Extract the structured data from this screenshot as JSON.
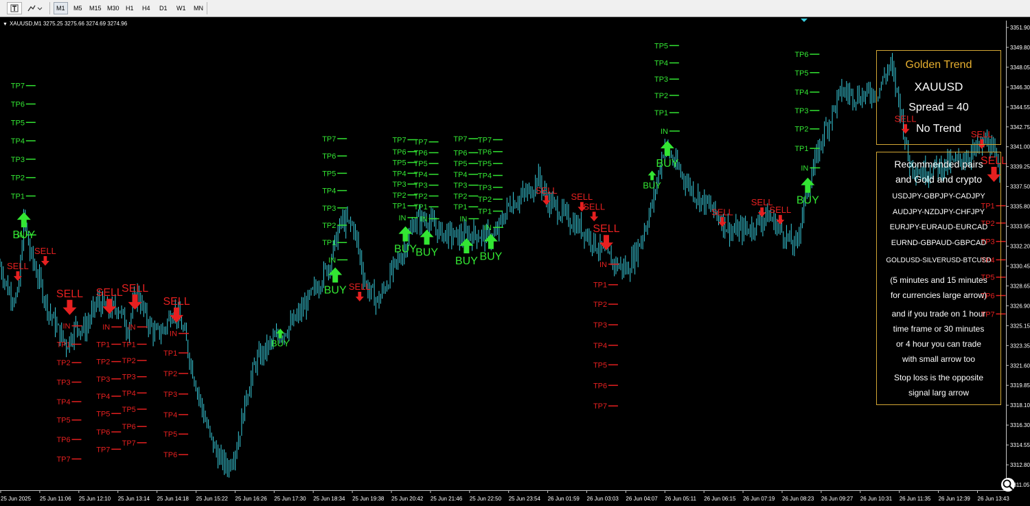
{
  "toolbar": {
    "icons": [
      "text-tool-icon",
      "shapes-tool-icon"
    ],
    "timeframes": [
      "M1",
      "M5",
      "M15",
      "M30",
      "H1",
      "H4",
      "D1",
      "W1",
      "MN"
    ],
    "active_timeframe": "M1"
  },
  "symbol_info": "XAUUSD,M1  3275.25 3275.66 3274.69 3274.96",
  "colors": {
    "background": "#000000",
    "candle": "#3ad0e0",
    "buy": "#33e633",
    "sell": "#e62020",
    "box_border": "#d4a835",
    "box_title": "#e8b030"
  },
  "info_box": {
    "title": "Golden Trend",
    "symbol": "XAUUSD",
    "spread": "Spread = 40",
    "trend": "No Trend"
  },
  "recommend_box": {
    "heading_line1": "Recommended pairs",
    "heading_line2": "and Gold and crypto",
    "pairs": [
      "USDJPY-GBPJPY-CADJPY",
      "AUDJPY-NZDJPY-CHFJPY",
      "EURJPY-EURAUD-EURCAD",
      "EURND-GBPAUD-GBPCAD",
      "GOLDUSD-SILVERUSD-BTCUSD"
    ],
    "note_lines": [
      "(5 minutes and 15 minutes",
      "for currencies large arrow)",
      "and if you trade on 1 hour",
      "time frame or 30 minutes",
      "or 4 hour you can trade",
      "with small arrow too",
      "Stop loss is the opposite",
      "signal larg arrow"
    ]
  },
  "price_axis": [
    "3351.90",
    "3349.80",
    "3348.05",
    "3346.30",
    "3344.55",
    "3342.75",
    "3341.00",
    "3339.25",
    "3337.50",
    "3335.80",
    "3333.95",
    "3332.20",
    "3330.45",
    "3328.65",
    "3326.90",
    "3325.15",
    "3323.35",
    "3321.60",
    "3319.85",
    "3318.10",
    "3316.30",
    "3314.55",
    "3312.80",
    "3311.05"
  ],
  "time_axis": [
    "25 Jun 2025",
    "25 Jun 11:06",
    "25 Jun 12:10",
    "25 Jun 13:14",
    "25 Jun 14:18",
    "25 Jun 15:22",
    "25 Jun 16:26",
    "25 Jun 17:30",
    "25 Jun 18:34",
    "25 Jun 19:38",
    "25 Jun 20:42",
    "25 Jun 21:46",
    "25 Jun 22:50",
    "25 Jun 23:54",
    "26 Jun 01:59",
    "26 Jun 03:03",
    "26 Jun 04:07",
    "26 Jun 05:11",
    "26 Jun 06:15",
    "26 Jun 07:19",
    "26 Jun 08:23",
    "26 Jun 09:27",
    "26 Jun 10:31",
    "26 Jun 11:35",
    "26 Jun 12:39",
    "26 Jun 13:43"
  ],
  "signals": [
    {
      "type": "buy",
      "size": "large",
      "x_time": "25 Jun 10:40",
      "entry": 3333.2,
      "arrow": 3334.6,
      "tp": [
        3336.8,
        3338.5,
        3340.2,
        3341.9,
        3343.6,
        3345.3,
        3347.0
      ]
    },
    {
      "type": "sell",
      "size": "small",
      "x_time": "25 Jun 10:30",
      "arrow": 3329.4
    },
    {
      "type": "sell",
      "size": "small",
      "x_time": "25 Jun 11:15",
      "arrow": 3330.8
    },
    {
      "type": "sell",
      "size": "large",
      "x_time": "25 Jun 11:55",
      "entry": 3324.8,
      "arrow": 3326.5,
      "tp": [
        3323.1,
        3321.4,
        3319.6,
        3317.8,
        3316.1,
        3314.3,
        3312.5
      ]
    },
    {
      "type": "sell",
      "size": "large",
      "x_time": "25 Jun 13:00",
      "entry": 3324.7,
      "arrow": 3326.6,
      "tp": [
        3323.1,
        3321.5,
        3319.9,
        3318.3,
        3316.7,
        3315.0,
        3313.4
      ]
    },
    {
      "type": "sell",
      "size": "large",
      "x_time": "25 Jun 13:42",
      "entry": 3324.7,
      "arrow": 3327.0,
      "tp": [
        3323.1,
        3321.6,
        3320.1,
        3318.6,
        3317.1,
        3315.5,
        3314.0
      ]
    },
    {
      "type": "sell",
      "size": "large",
      "x_time": "25 Jun 14:50",
      "entry": 3324.1,
      "arrow": 3325.8,
      "tp": [
        3322.3,
        3320.4,
        3318.5,
        3316.6,
        3314.8,
        3312.9
      ]
    },
    {
      "type": "buy",
      "size": "small",
      "x_time": "25 Jun 17:40",
      "arrow": 3324.1
    },
    {
      "type": "buy",
      "size": "large",
      "x_time": "25 Jun 19:10",
      "entry": 3330.9,
      "arrow": 3329.5,
      "tp": [
        3332.5,
        3334.1,
        3335.7,
        3337.3,
        3338.9,
        3340.5,
        3342.1
      ]
    },
    {
      "type": "sell",
      "size": "small",
      "x_time": "25 Jun 19:50",
      "arrow": 3327.5
    },
    {
      "type": "buy",
      "size": "large",
      "x_time": "25 Jun 21:05",
      "entry": 3334.8,
      "arrow": 3333.3,
      "tp": [
        3335.9,
        3336.9,
        3337.9,
        3338.9,
        3339.9,
        3340.9,
        3342.0
      ]
    },
    {
      "type": "buy",
      "size": "large",
      "x_time": "25 Jun 21:40",
      "entry": 3334.7,
      "arrow": 3333.0,
      "tp": [
        3335.8,
        3336.8,
        3337.8,
        3338.8,
        3339.8,
        3340.8,
        3341.8
      ]
    },
    {
      "type": "buy",
      "size": "large",
      "x_time": "25 Jun 22:45",
      "entry": 3334.7,
      "arrow": 3332.2,
      "tp": [
        3335.8,
        3336.8,
        3337.8,
        3338.8,
        3339.8,
        3340.8,
        3342.1
      ]
    },
    {
      "type": "buy",
      "size": "large",
      "x_time": "25 Jun 23:25",
      "entry": 3333.9,
      "arrow": 3332.6,
      "tp": [
        3335.4,
        3336.5,
        3337.6,
        3338.7,
        3339.8,
        3340.9,
        3342.0
      ]
    },
    {
      "type": "sell",
      "size": "small",
      "x_time": "26 Jun 01:55",
      "arrow": 3336.4
    },
    {
      "type": "sell",
      "size": "small",
      "x_time": "26 Jun 02:55",
      "arrow": 3335.8
    },
    {
      "type": "sell",
      "size": "small",
      "x_time": "26 Jun 03:15",
      "arrow": 3334.9
    },
    {
      "type": "sell",
      "size": "large",
      "x_time": "26 Jun 03:35",
      "entry": 3330.5,
      "arrow": 3332.5,
      "tp": [
        3328.6,
        3326.8,
        3324.9,
        3323.0,
        3321.2,
        3319.3,
        3317.4
      ]
    },
    {
      "type": "buy",
      "size": "small",
      "x_time": "26 Jun 04:50",
      "arrow": 3338.7
    },
    {
      "type": "buy",
      "size": "large",
      "x_time": "26 Jun 05:15",
      "entry": 3342.8,
      "arrow": 3341.2,
      "tp": [
        3344.5,
        3346.1,
        3347.6,
        3349.1,
        3350.7
      ]
    },
    {
      "type": "sell",
      "size": "small",
      "x_time": "26 Jun 06:45",
      "arrow": 3334.4
    },
    {
      "type": "sell",
      "size": "small",
      "x_time": "26 Jun 07:50",
      "arrow": 3335.3
    },
    {
      "type": "sell",
      "size": "small",
      "x_time": "26 Jun 08:20",
      "arrow": 3334.6
    },
    {
      "type": "buy",
      "size": "large",
      "x_time": "26 Jun 09:05",
      "entry": 3339.4,
      "arrow": 3337.8,
      "tp": [
        3341.2,
        3343.0,
        3344.7,
        3346.4,
        3348.2,
        3349.9
      ]
    },
    {
      "type": "sell",
      "size": "small",
      "x_time": "26 Jun 11:45",
      "arrow": 3343.0
    },
    {
      "type": "sell",
      "size": "small",
      "x_time": "26 Jun 13:50",
      "arrow": 3341.6
    },
    {
      "type": "sell",
      "size": "large",
      "x_time": "26 Jun 14:10",
      "arrow": 3338.8,
      "tp": [
        3335.9,
        3334.3,
        3332.6,
        3330.9,
        3329.3,
        3327.6,
        3325.9
      ]
    }
  ],
  "chart_data": {
    "type": "line",
    "series": [
      {
        "x": [
          "25 Jun 10:00",
          "25 Jun 10:15",
          "25 Jun 10:30",
          "25 Jun 10:40",
          "25 Jun 10:50",
          "25 Jun 11:05",
          "25 Jun 11:20",
          "25 Jun 11:35",
          "25 Jun 11:50",
          "25 Jun 12:05",
          "25 Jun 12:20",
          "25 Jun 12:40",
          "25 Jun 13:00",
          "25 Jun 13:15",
          "25 Jun 13:30",
          "25 Jun 13:45",
          "25 Jun 14:00",
          "25 Jun 14:15",
          "25 Jun 14:30",
          "25 Jun 14:45",
          "25 Jun 15:00",
          "25 Jun 15:15",
          "25 Jun 15:30",
          "25 Jun 15:45",
          "25 Jun 16:00",
          "25 Jun 16:15",
          "25 Jun 16:30",
          "25 Jun 16:45",
          "25 Jun 17:00",
          "25 Jun 17:30",
          "25 Jun 18:00",
          "25 Jun 18:30",
          "25 Jun 19:00",
          "25 Jun 19:20",
          "25 Jun 19:40",
          "25 Jun 20:00",
          "25 Jun 20:20",
          "25 Jun 20:40",
          "25 Jun 21:00",
          "25 Jun 21:20",
          "25 Jun 21:40",
          "25 Jun 22:00",
          "25 Jun 22:30",
          "25 Jun 23:00",
          "25 Jun 23:30",
          "25 Jun 23:55",
          "26 Jun 01:00",
          "26 Jun 01:30",
          "26 Jun 01:55",
          "26 Jun 02:30",
          "26 Jun 03:00",
          "26 Jun 03:30",
          "26 Jun 03:50",
          "26 Jun 04:10",
          "26 Jun 04:30",
          "26 Jun 04:50",
          "26 Jun 05:10",
          "26 Jun 05:30",
          "26 Jun 06:00",
          "26 Jun 06:30",
          "26 Jun 07:00",
          "26 Jun 07:30",
          "26 Jun 08:00",
          "26 Jun 08:30",
          "26 Jun 08:45",
          "26 Jun 09:00",
          "26 Jun 09:30",
          "26 Jun 10:00",
          "26 Jun 10:30",
          "26 Jun 11:00",
          "26 Jun 11:20",
          "26 Jun 11:35",
          "26 Jun 11:50",
          "26 Jun 12:10",
          "26 Jun 12:40",
          "26 Jun 13:10",
          "26 Jun 13:40",
          "26 Jun 14:00",
          "26 Jun 14:20"
        ],
        "y": [
          3330.5,
          3328.0,
          3327.2,
          3334.8,
          3331.5,
          3329.0,
          3326.3,
          3324.5,
          3323.0,
          3324.8,
          3324.5,
          3327.0,
          3326.2,
          3326.6,
          3324.5,
          3328.0,
          3325.5,
          3324.0,
          3324.5,
          3326.5,
          3324.6,
          3321.0,
          3317.5,
          3314.5,
          3312.5,
          3311.8,
          3314.0,
          3318.5,
          3321.5,
          3323.5,
          3325.0,
          3327.5,
          3330.5,
          3334.5,
          3334.0,
          3328.5,
          3327.0,
          3329.5,
          3331.5,
          3334.5,
          3334.7,
          3333.5,
          3333.0,
          3333.3,
          3332.9,
          3336.0,
          3337.2,
          3338.5,
          3336.5,
          3334.8,
          3333.5,
          3331.5,
          3330.5,
          3330.0,
          3332.5,
          3336.0,
          3341.5,
          3339.5,
          3337.0,
          3335.5,
          3333.5,
          3333.8,
          3335.0,
          3333.0,
          3332.0,
          3336.5,
          3342.5,
          3346.5,
          3346.0,
          3346.5,
          3349.0,
          3345.5,
          3340.0,
          3339.0,
          3339.5,
          3340.0,
          3341.0,
          3342.0,
          3339.0
        ]
      }
    ],
    "ylim": [
      3310.5,
      3352.5
    ],
    "grid": false
  }
}
